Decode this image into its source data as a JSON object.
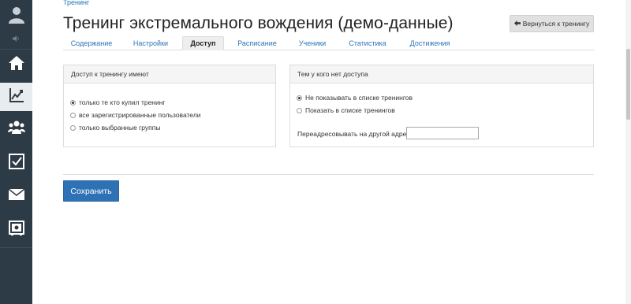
{
  "breadcrumb": "Тренинг",
  "page_title": "Тренинг экстремального вождения (демо-данные)",
  "back_button": {
    "label": "Вернуться к тренингу",
    "icon": "arrow-left-icon"
  },
  "sidebar": {
    "items": [
      {
        "name": "home-icon",
        "active": false
      },
      {
        "name": "chart-icon",
        "active": true
      },
      {
        "name": "users-icon",
        "active": false
      },
      {
        "name": "checkbox-icon",
        "active": false
      },
      {
        "name": "mail-icon",
        "active": false
      },
      {
        "name": "safe-icon",
        "active": false
      }
    ]
  },
  "tabs": [
    {
      "label": "Содержание",
      "active": false
    },
    {
      "label": "Настройки",
      "active": false
    },
    {
      "label": "Доступ",
      "active": true
    },
    {
      "label": "Расписание",
      "active": false
    },
    {
      "label": "Ученики",
      "active": false
    },
    {
      "label": "Статистика",
      "active": false
    },
    {
      "label": "Достижения",
      "active": false
    }
  ],
  "access_panel": {
    "title": "Доступ к тренингу имеют",
    "options": [
      {
        "label": "только те кто купил тренинг",
        "checked": true
      },
      {
        "label": "все зарегистрированные пользователи",
        "checked": false
      },
      {
        "label": "только выбранные группы",
        "checked": false
      }
    ]
  },
  "no_access_panel": {
    "title": "Тем у кого нет доступа",
    "options": [
      {
        "label": "Не показывать в списке тренингов",
        "checked": true
      },
      {
        "label": "Показать в списке тренингов",
        "checked": false
      }
    ],
    "redirect_label": "Переадресовывать на другой адрес",
    "redirect_value": ""
  },
  "save_button": {
    "label": "Сохранить"
  },
  "colors": {
    "accent": "#2e72b5",
    "link": "#2a73b8",
    "sidebar": "#2d3b47"
  }
}
